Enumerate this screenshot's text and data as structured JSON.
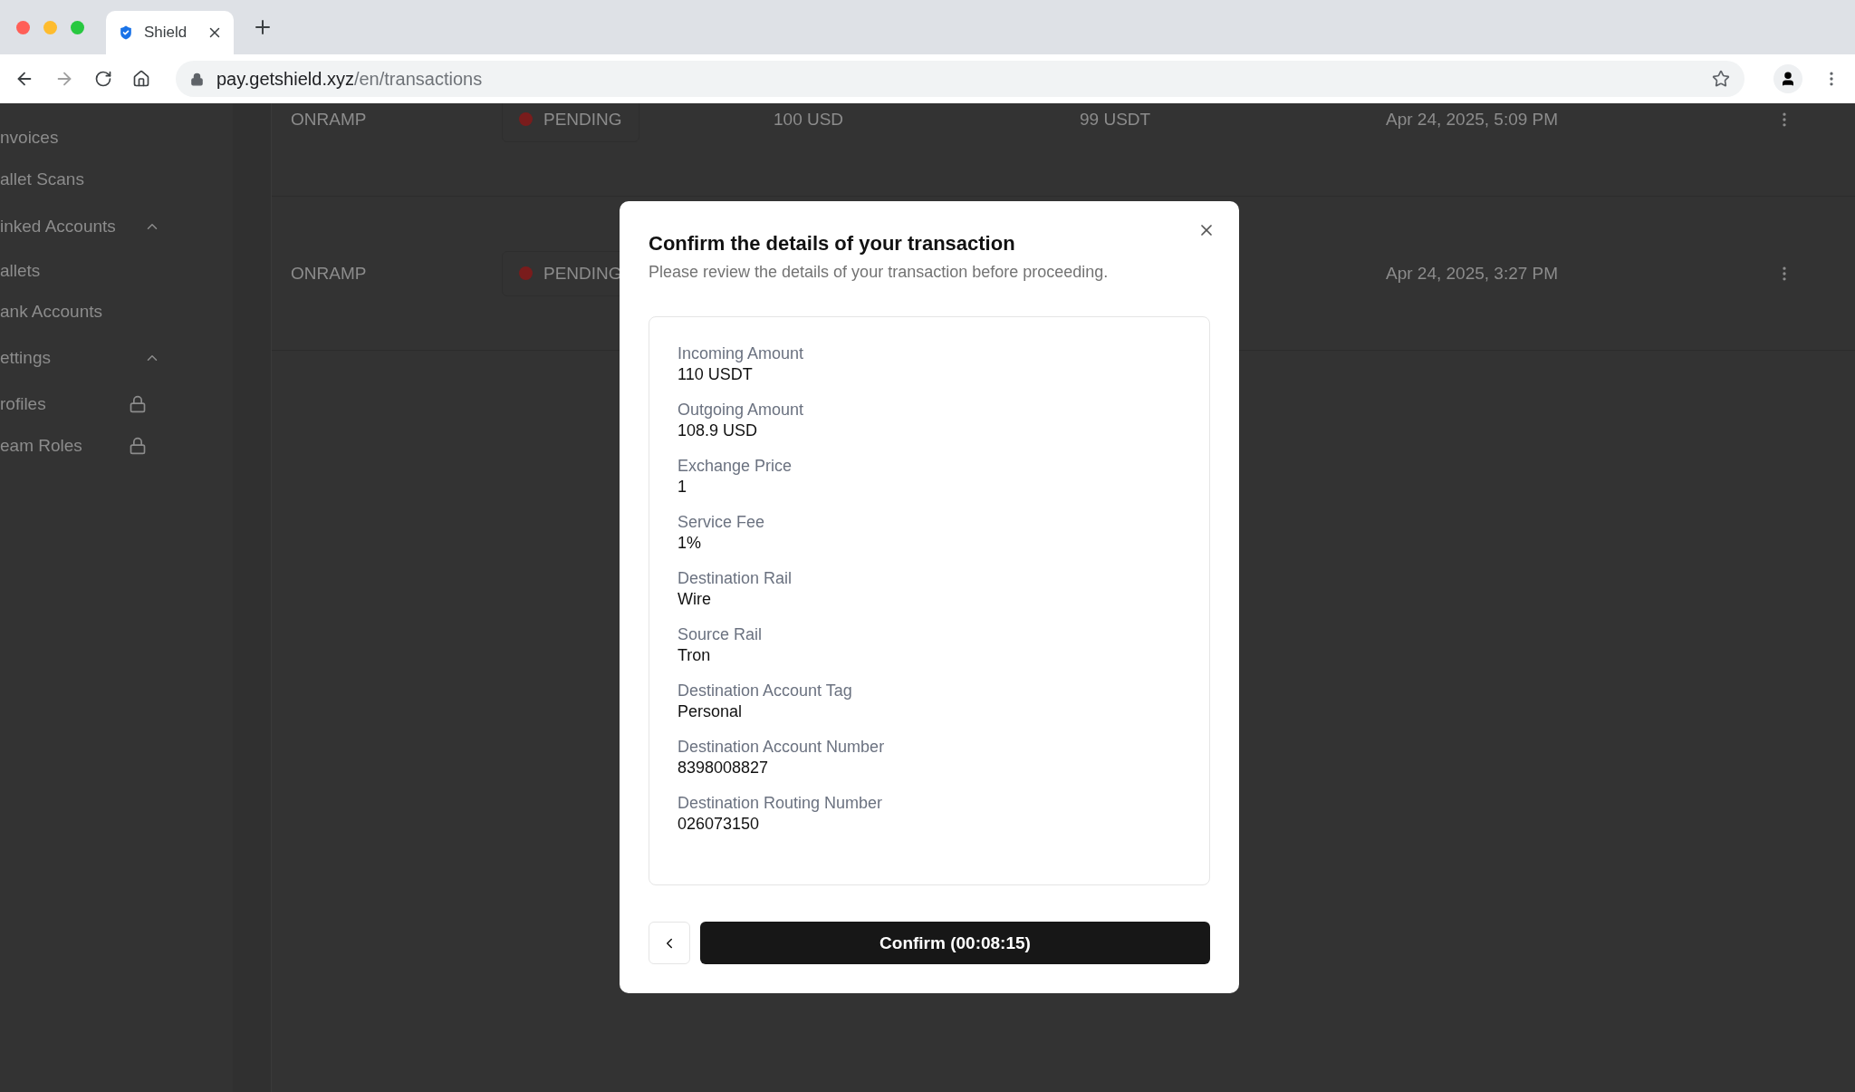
{
  "browser": {
    "tab_title": "Shield",
    "url_host": "pay.getshield.xyz",
    "url_path": "/en/transactions"
  },
  "sidebar": {
    "items": [
      {
        "kind": "link",
        "label": "nvoices"
      },
      {
        "kind": "link",
        "label": "allet Scans"
      },
      {
        "kind": "section",
        "label": "inked Accounts",
        "expanded": true
      },
      {
        "kind": "link",
        "label": "allets"
      },
      {
        "kind": "link",
        "label": "ank Accounts"
      },
      {
        "kind": "section",
        "label": "ettings",
        "expanded": true
      },
      {
        "kind": "link",
        "label": "rofiles",
        "locked": true
      },
      {
        "kind": "link",
        "label": "eam Roles",
        "locked": true
      }
    ]
  },
  "table": {
    "rows": [
      {
        "type": "ONRAMP",
        "status": "PENDING",
        "amount": "100 USD",
        "received": "99 USDT",
        "date": "Apr 24, 2025, 5:09 PM"
      },
      {
        "type": "ONRAMP",
        "status": "PENDING",
        "date": "Apr 24, 2025, 3:27 PM"
      }
    ]
  },
  "modal": {
    "title": "Confirm the details of your transaction",
    "subtitle": "Please review the details of your transaction before proceeding.",
    "details": [
      {
        "label": "Incoming Amount",
        "value": "110 USDT"
      },
      {
        "label": "Outgoing Amount",
        "value": "108.9 USD"
      },
      {
        "label": "Exchange Price",
        "value": "1"
      },
      {
        "label": "Service Fee",
        "value": "1%"
      },
      {
        "label": "Destination Rail",
        "value": "Wire"
      },
      {
        "label": "Source Rail",
        "value": "Tron"
      },
      {
        "label": "Destination Account Tag",
        "value": "Personal"
      },
      {
        "label": "Destination Account Number",
        "value": "8398008827"
      },
      {
        "label": "Destination Routing Number",
        "value": "026073150"
      }
    ],
    "confirm_label": "Confirm (00:08:15)"
  }
}
